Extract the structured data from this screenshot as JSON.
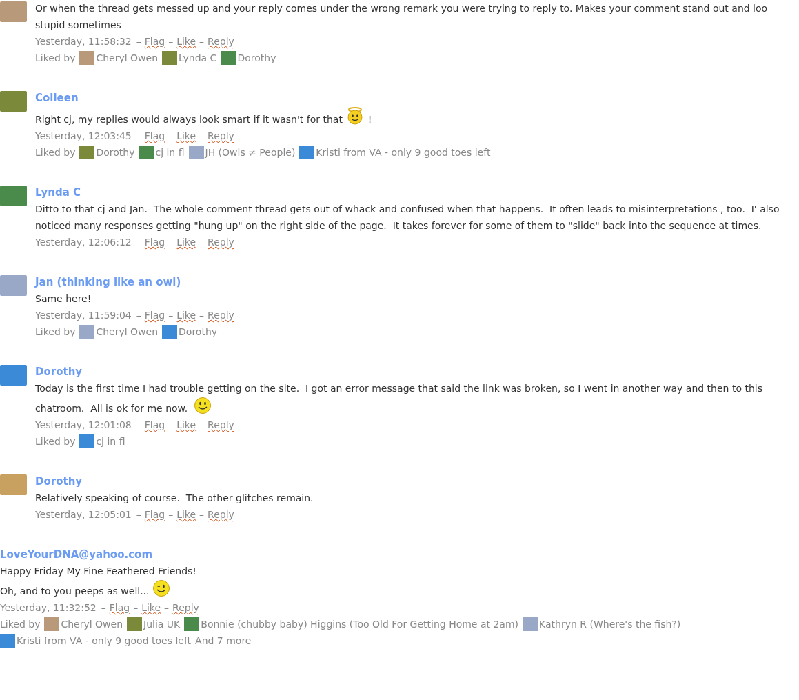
{
  "comments": [
    {
      "kind": "member",
      "paragraphs": [
        [
          {
            "kind": "text",
            "text": "Or when the thread gets messed up and your reply comes under the wrong remark you were trying to reply to. Makes your comment stand out and loo stupid sometimes"
          }
        ]
      ],
      "time": "Yesterday, 11:58:32",
      "separator": "–",
      "actions": [
        "Flag",
        "Like",
        "Reply"
      ],
      "liked_label": "Liked by",
      "liked_by": [
        "Cheryl Owen",
        "Lynda C",
        "Dorothy"
      ]
    },
    {
      "kind": "member",
      "author": "Colleen",
      "paragraphs": [
        [
          {
            "kind": "text",
            "text": "Right cj, my replies would always look smart if it wasn't for that "
          },
          {
            "kind": "halo"
          },
          {
            "kind": "text",
            "text": " !"
          }
        ]
      ],
      "time": "Yesterday, 12:03:45",
      "separator": "–",
      "actions": [
        "Flag",
        "Like",
        "Reply"
      ],
      "liked_label": "Liked by",
      "liked_by": [
        "Dorothy",
        "cj in fl",
        "JH (Owls ≠ People)",
        "Kristi from VA - only 9 good toes left"
      ]
    },
    {
      "kind": "member",
      "author": "Lynda C",
      "paragraphs": [
        [
          {
            "kind": "text",
            "text": "Ditto to that cj and Jan.  The whole comment thread gets out of whack and confused when that happens.  It often leads to misinterpretations , too.  I' also noticed many responses getting \"hung up\" on the right side of the page.  It takes forever for some of them to \"slide\" back into the sequence at times."
          }
        ]
      ],
      "time": "Yesterday, 12:06:12",
      "separator": "–",
      "actions": [
        "Flag",
        "Like",
        "Reply"
      ]
    },
    {
      "kind": "member",
      "author": "Jan (thinking like an owl)",
      "paragraphs": [
        [
          {
            "kind": "text",
            "text": "Same here!"
          }
        ]
      ],
      "time": "Yesterday, 11:59:04",
      "separator": "–",
      "actions": [
        "Flag",
        "Like",
        "Reply"
      ],
      "liked_label": "Liked by",
      "liked_by": [
        "Cheryl Owen",
        "Dorothy"
      ]
    },
    {
      "kind": "member",
      "author": "Dorothy",
      "paragraphs": [
        [
          {
            "kind": "text",
            "text": "Today is the first time I had trouble getting on the site.  I got an error message that said the link was broken, so I went in another way and then to this chatroom.  All is ok for me now.  "
          },
          {
            "kind": "smile"
          }
        ]
      ],
      "time": "Yesterday, 12:01:08",
      "separator": "–",
      "actions": [
        "Flag",
        "Like",
        "Reply"
      ],
      "liked_label": "Liked by",
      "liked_by": [
        "cj in fl"
      ]
    },
    {
      "kind": "member",
      "author": "Dorothy",
      "paragraphs": [
        [
          {
            "kind": "text",
            "text": "Relatively speaking of course.  The other glitches remain."
          }
        ]
      ],
      "time": "Yesterday, 12:05:01",
      "separator": "–",
      "actions": [
        "Flag",
        "Like",
        "Reply"
      ]
    },
    {
      "kind": "guest",
      "author": "LoveYourDNA@yahoo.com",
      "paragraphs": [
        [
          {
            "kind": "text",
            "text": "Happy Friday My Fine Feathered Friends!"
          }
        ],
        [
          {
            "kind": "text",
            "text": "Oh, and to you peeps as well... "
          },
          {
            "kind": "wink"
          }
        ]
      ],
      "time": "Yesterday, 11:32:52",
      "separator": "–",
      "actions": [
        "Flag",
        "Like",
        "Reply"
      ],
      "liked_label": "Liked by",
      "liked_by": [
        "Cheryl Owen",
        "Julia UK",
        "Bonnie (chubby baby) Higgins (Too Old For Getting Home at 2am)",
        "Kathryn R (Where's the fish?)",
        "Kristi from VA - only 9 good toes left"
      ],
      "more": "And 7 more"
    }
  ]
}
